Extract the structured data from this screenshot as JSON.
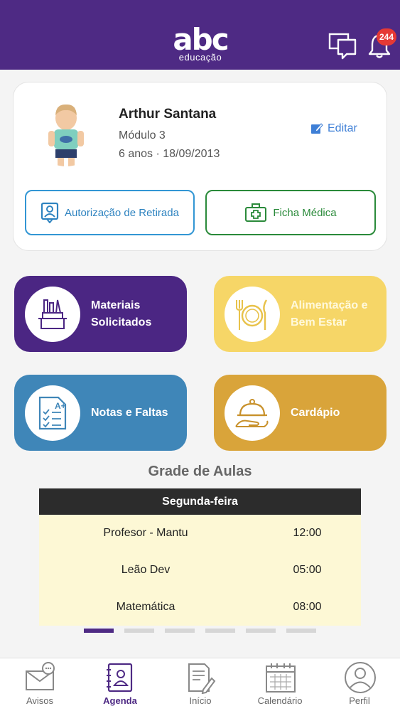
{
  "header": {
    "logo_main": "abc",
    "logo_sub": "educação",
    "notification_count": "244",
    "colors": {
      "background": "#4e2a84",
      "badge": "#e53935"
    }
  },
  "profile": {
    "name": "Arthur Santana",
    "module": "Módulo 3",
    "age_birth": "6 anos · 18/09/2013",
    "edit_label": "Editar",
    "auth_label": "Autorização de Retirada",
    "medical_label": "Ficha Médica"
  },
  "tiles": [
    {
      "label_1": "Materiais",
      "label_2": "Solicitados",
      "color": "#4b2683",
      "icon": "desk-supplies-icon"
    },
    {
      "label_1": "Alimentação e",
      "label_2": "Bem Estar",
      "color": "#f6d667",
      "icon": "plate-cutlery-icon"
    },
    {
      "label_1": "Notas e Faltas",
      "color": "#3f86b8",
      "icon": "grades-checklist-icon"
    },
    {
      "label_1": "Cardápio",
      "color": "#d9a43a",
      "icon": "serving-cloche-icon"
    }
  ],
  "schedule": {
    "title": "Grade de Aulas",
    "day": "Segunda-feira",
    "rows": [
      {
        "subject": "Profesor - Mantu",
        "time": "12:00"
      },
      {
        "subject": "Leão Dev",
        "time": "05:00"
      },
      {
        "subject": "Matemática",
        "time": "08:00"
      }
    ],
    "pages": 6,
    "active_page": 1
  },
  "nav": {
    "items": [
      {
        "label": "Avisos",
        "icon": "mail-chat-icon"
      },
      {
        "label": "Agenda",
        "icon": "agenda-icon",
        "active": true
      },
      {
        "label": "Início",
        "icon": "document-pencil-icon"
      },
      {
        "label": "Calendário",
        "icon": "calendar-icon"
      },
      {
        "label": "Perfil",
        "icon": "user-circle-icon"
      }
    ]
  }
}
